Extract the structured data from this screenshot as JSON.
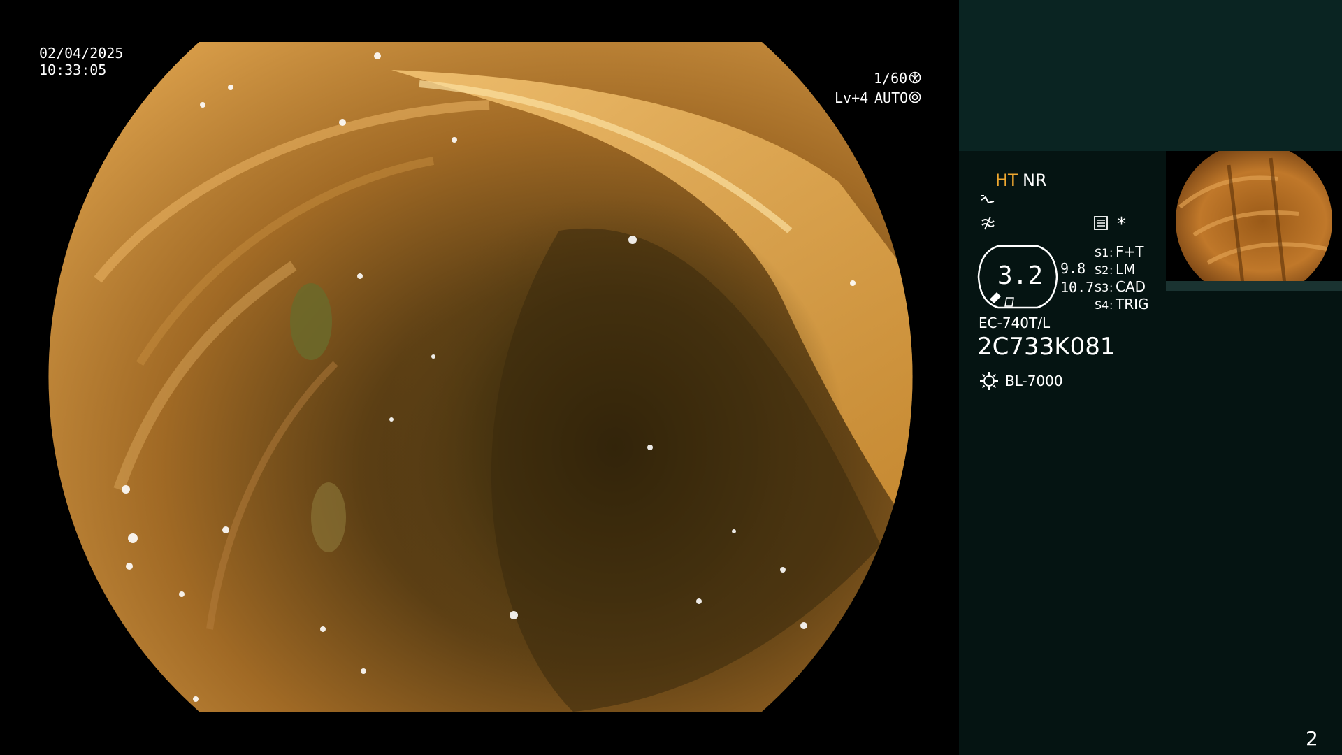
{
  "exam": {
    "date": "02/04/2025",
    "time": "10:33:05"
  },
  "camera": {
    "shutter": "1/60",
    "level": "Lv+4",
    "iris_mode": "AUTO"
  },
  "modes": {
    "ht": "HT",
    "nr": "NR"
  },
  "zoom": {
    "value": "3.2",
    "upper": "9.8",
    "lower": "10.7"
  },
  "switches": [
    {
      "key": "S1",
      "label": "F+T"
    },
    {
      "key": "S2",
      "label": "LM"
    },
    {
      "key": "S3",
      "label": "CAD"
    },
    {
      "key": "S4",
      "label": "TRIG"
    }
  ],
  "scope": {
    "model": "EC-740T/L",
    "serial": "2C733K081"
  },
  "light_source": "BL-7000",
  "asterisk": "*",
  "page_number": "2",
  "colors": {
    "ht_accent": "#f0a830",
    "panel_bg": "#051412",
    "panel_top": "#0a2422"
  },
  "icons": [
    "shutter-icon",
    "iris-icon",
    "tilde-icon",
    "not-equal-icon",
    "menu-icon",
    "brightness-icon"
  ]
}
